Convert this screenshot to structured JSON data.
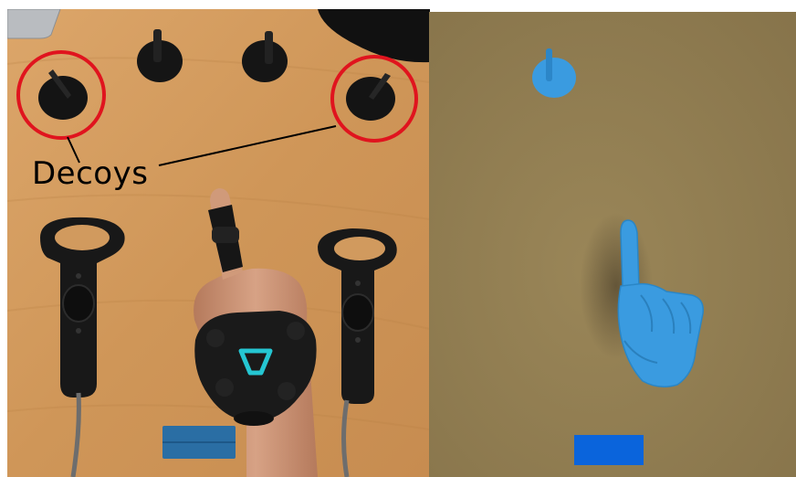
{
  "left_photo": {
    "annotation_label": "Decoys",
    "highlight_color": "#e0141e"
  },
  "right_render": {
    "hand_color": "#3a9be0",
    "marker_color": "#0a64dc",
    "table_color": "#8f7c52"
  }
}
